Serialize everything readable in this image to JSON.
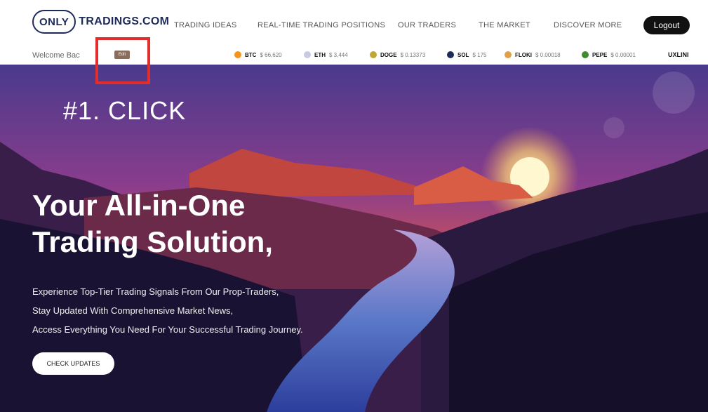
{
  "header": {
    "logo_badge": "ONLY",
    "logo_text": "TRADINGS.COM",
    "nav": [
      "TRADING IDEAS",
      "REAL-TIME TRADING POSITIONS",
      "OUR TRADERS",
      "THE MARKET",
      "DISCOVER MORE"
    ],
    "logout_label": "Logout"
  },
  "ticker": {
    "welcome": "Welcome Bac",
    "edit_label": "Edit",
    "coins": [
      {
        "symbol": "BTC",
        "price": "$ 66,620",
        "color": "#f7931a"
      },
      {
        "symbol": "ETH",
        "price": "$ 3,444",
        "color": "#c8cbe0"
      },
      {
        "symbol": "DOGE",
        "price": "$ 0.13373",
        "color": "#c2a633"
      },
      {
        "symbol": "SOL",
        "price": "$ 175",
        "color": "#1e2a5a"
      },
      {
        "symbol": "FLOKI",
        "price": "$ 0.00018",
        "color": "#e0a04a"
      },
      {
        "symbol": "PEPE",
        "price": "$ 0.00001",
        "color": "#3d8c2e"
      }
    ],
    "user_tag": "UXLINI"
  },
  "annotation": {
    "label": "#1. CLICK",
    "color": "#e22d2d"
  },
  "hero": {
    "title_line1": "Your All-in-One",
    "title_line2": "Trading Solution,",
    "sub_lines": [
      "Experience Top-Tier Trading Signals From Our Prop-Traders,",
      "Stay Updated With Comprehensive Market News,",
      "Access Everything You Need For Your Successful Trading Journey."
    ],
    "cta_label": "CHECK UPDATES"
  }
}
